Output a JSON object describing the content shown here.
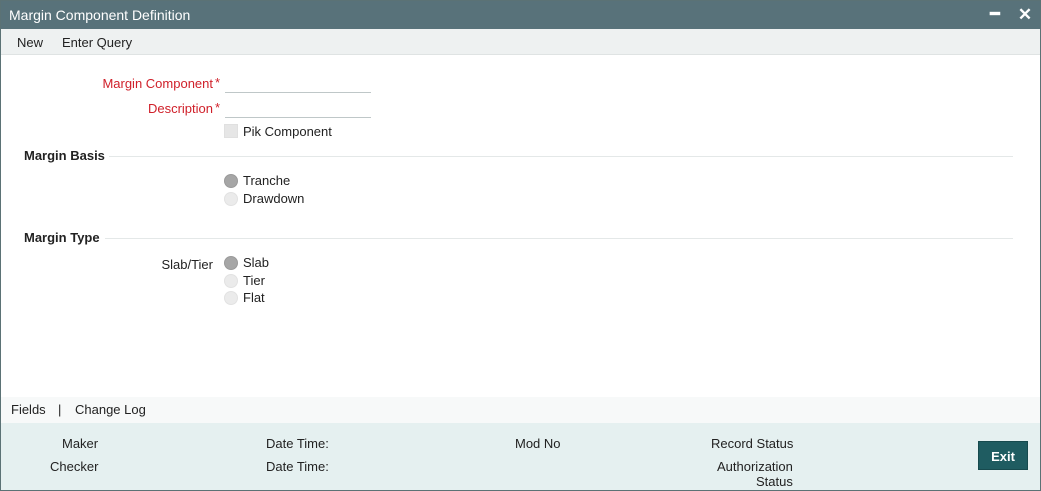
{
  "window": {
    "title": "Margin Component Definition",
    "minimize_icon": "minimize-icon",
    "close_icon": "close-icon"
  },
  "toolbar": {
    "new_label": "New",
    "enter_query_label": "Enter Query"
  },
  "form": {
    "margin_component_label": "Margin Component",
    "margin_component_value": "",
    "description_label": "Description",
    "description_value": "",
    "required_marker": "*",
    "pik_component_label": "Pik Component",
    "pik_component_checked": false
  },
  "margin_basis": {
    "title": "Margin Basis",
    "options": [
      {
        "label": "Tranche",
        "selected": true
      },
      {
        "label": "Drawdown",
        "selected": false
      }
    ]
  },
  "margin_type": {
    "title": "Margin Type",
    "slab_tier_label": "Slab/Tier",
    "options": [
      {
        "label": "Slab",
        "selected": true
      },
      {
        "label": "Tier",
        "selected": false
      },
      {
        "label": "Flat",
        "selected": false
      }
    ]
  },
  "footer_links": {
    "fields": "Fields",
    "separator": "|",
    "change_log": "Change Log"
  },
  "audit": {
    "maker": "Maker",
    "checker": "Checker",
    "date_time_1": "Date Time:",
    "date_time_2": "Date Time:",
    "mod_no": "Mod No",
    "record_status": "Record Status",
    "authorization": "Authorization",
    "status": "Status",
    "exit_label": "Exit"
  },
  "colors": {
    "titlebar": "#58727a",
    "required": "#d0202a",
    "exit_button": "#1f5c61",
    "audit_bg": "#e5f0f0"
  }
}
